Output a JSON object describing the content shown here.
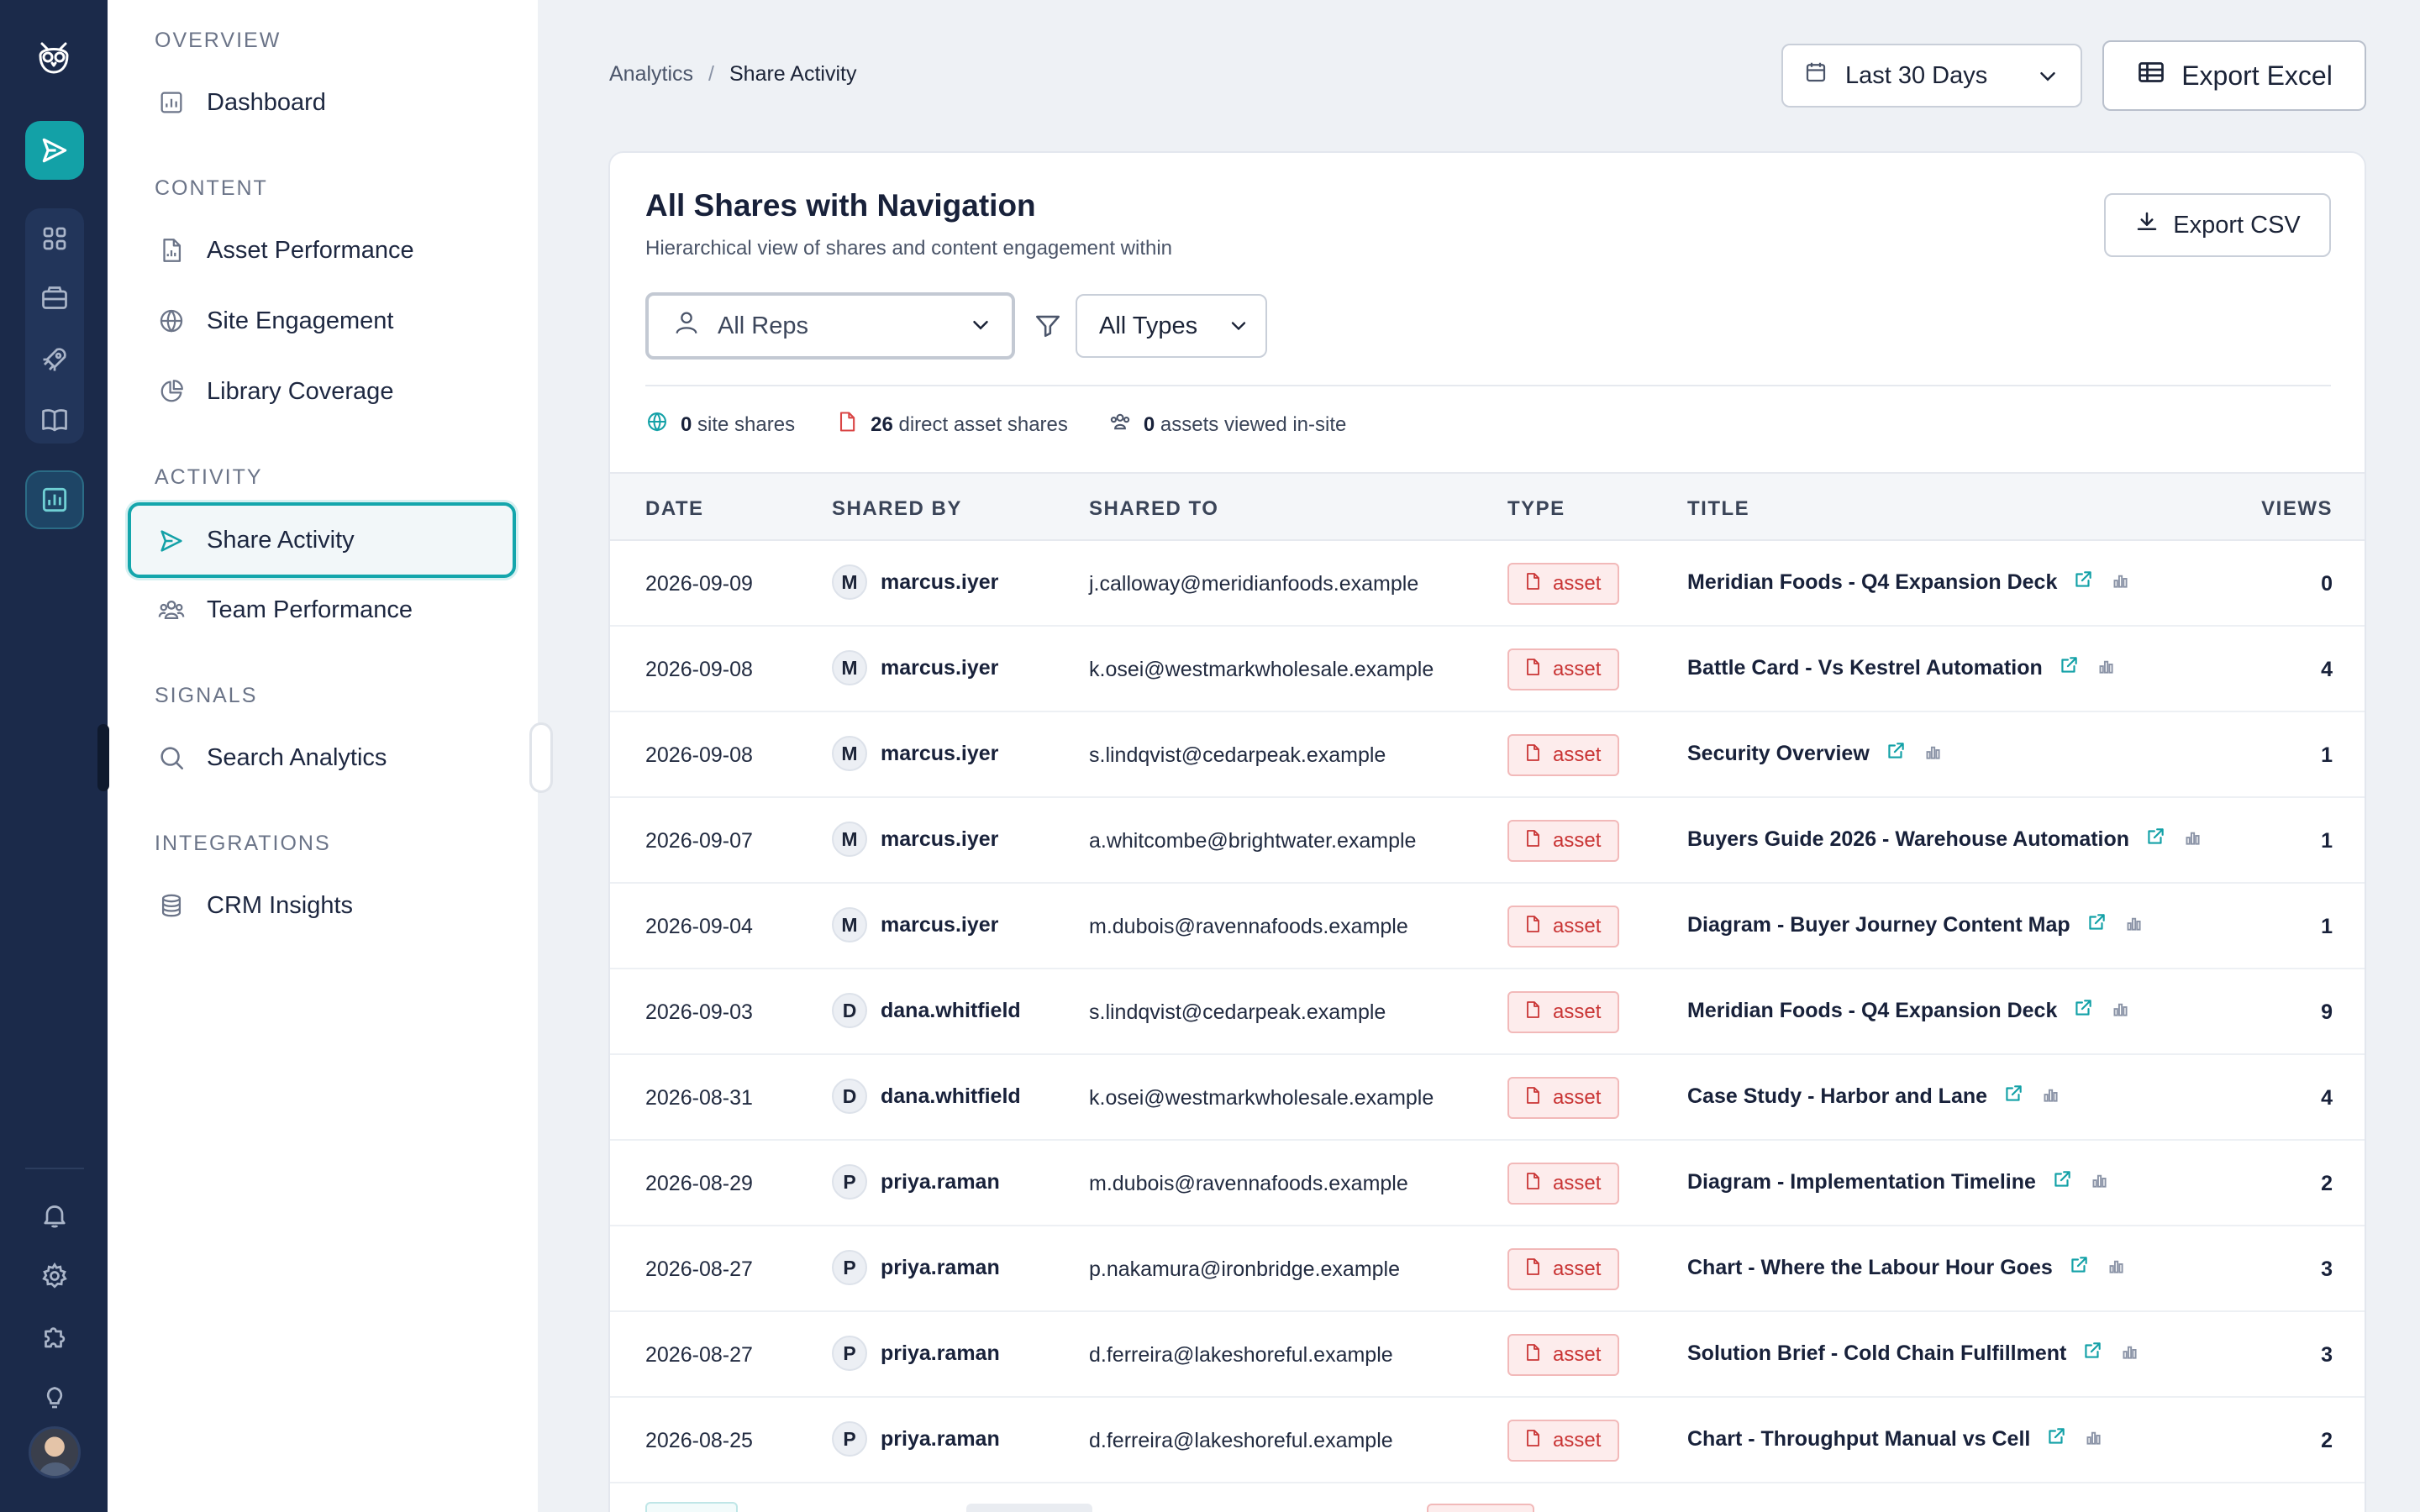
{
  "breadcrumb": {
    "parent": "Analytics",
    "separator": "/",
    "current": "Share Activity"
  },
  "date_range": {
    "value": "Last 30 Days"
  },
  "export_excel_label": "Export Excel",
  "sidebar": {
    "sections": [
      {
        "label": "OVERVIEW",
        "items": [
          {
            "label": "Dashboard",
            "icon": "bar-chart-icon"
          }
        ]
      },
      {
        "label": "CONTENT",
        "items": [
          {
            "label": "Asset Performance",
            "icon": "document-chart-icon"
          },
          {
            "label": "Site Engagement",
            "icon": "globe-icon"
          },
          {
            "label": "Library Coverage",
            "icon": "pie-chart-icon"
          }
        ]
      },
      {
        "label": "ACTIVITY",
        "items": [
          {
            "label": "Share Activity",
            "icon": "send-icon",
            "active": true
          },
          {
            "label": "Team Performance",
            "icon": "users-icon"
          }
        ]
      },
      {
        "label": "SIGNALS",
        "items": [
          {
            "label": "Search Analytics",
            "icon": "search-icon"
          }
        ]
      },
      {
        "label": "INTEGRATIONS",
        "items": [
          {
            "label": "CRM Insights",
            "icon": "database-icon"
          }
        ]
      }
    ]
  },
  "card": {
    "title": "All Shares with Navigation",
    "subtitle": "Hierarchical view of shares and content engagement within",
    "export_csv_label": "Export CSV",
    "rep_filter": "All Reps",
    "type_filter": "All Types",
    "stats": {
      "site_shares_count": "0",
      "site_shares_label": "site shares",
      "direct_count": "26",
      "direct_label": "direct asset shares",
      "viewed_count": "0",
      "viewed_label": "assets viewed in-site"
    }
  },
  "table": {
    "headers": {
      "date": "DATE",
      "shared_by": "SHARED BY",
      "shared_to": "SHARED TO",
      "type": "TYPE",
      "title": "TITLE",
      "views": "VIEWS"
    },
    "rows": [
      {
        "date": "2026-09-09",
        "initial": "M",
        "by": "marcus.iyer",
        "to": "j.calloway@meridianfoods.example",
        "type": "asset",
        "title": "Meridian Foods - Q4 Expansion Deck",
        "views": "0"
      },
      {
        "date": "2026-09-08",
        "initial": "M",
        "by": "marcus.iyer",
        "to": "k.osei@westmarkwholesale.example",
        "type": "asset",
        "title": "Battle Card - Vs Kestrel Automation",
        "views": "4"
      },
      {
        "date": "2026-09-08",
        "initial": "M",
        "by": "marcus.iyer",
        "to": "s.lindqvist@cedarpeak.example",
        "type": "asset",
        "title": "Security Overview",
        "views": "1"
      },
      {
        "date": "2026-09-07",
        "initial": "M",
        "by": "marcus.iyer",
        "to": "a.whitcombe@brightwater.example",
        "type": "asset",
        "title": "Buyers Guide 2026 - Warehouse Automation",
        "views": "1"
      },
      {
        "date": "2026-09-04",
        "initial": "M",
        "by": "marcus.iyer",
        "to": "m.dubois@ravennafoods.example",
        "type": "asset",
        "title": "Diagram - Buyer Journey Content Map",
        "views": "1"
      },
      {
        "date": "2026-09-03",
        "initial": "D",
        "by": "dana.whitfield",
        "to": "s.lindqvist@cedarpeak.example",
        "type": "asset",
        "title": "Meridian Foods - Q4 Expansion Deck",
        "views": "9"
      },
      {
        "date": "2026-08-31",
        "initial": "D",
        "by": "dana.whitfield",
        "to": "k.osei@westmarkwholesale.example",
        "type": "asset",
        "title": "Case Study - Harbor and Lane",
        "views": "4"
      },
      {
        "date": "2026-08-29",
        "initial": "P",
        "by": "priya.raman",
        "to": "m.dubois@ravennafoods.example",
        "type": "asset",
        "title": "Diagram - Implementation Timeline",
        "views": "2"
      },
      {
        "date": "2026-08-27",
        "initial": "P",
        "by": "priya.raman",
        "to": "p.nakamura@ironbridge.example",
        "type": "asset",
        "title": "Chart - Where the Labour Hour Goes",
        "views": "3"
      },
      {
        "date": "2026-08-27",
        "initial": "P",
        "by": "priya.raman",
        "to": "d.ferreira@lakeshoreful.example",
        "type": "asset",
        "title": "Solution Brief - Cold Chain Fulfillment",
        "views": "3"
      },
      {
        "date": "2026-08-25",
        "initial": "P",
        "by": "priya.raman",
        "to": "d.ferreira@lakeshoreful.example",
        "type": "asset",
        "title": "Chart - Throughput Manual vs Cell",
        "views": "2"
      }
    ]
  },
  "rail": {
    "icons": [
      "owl-logo-icon",
      "send-icon",
      "grid-icon",
      "inbox-icon",
      "rocket-icon",
      "book-icon",
      "analytics-icon",
      "bell-icon",
      "gear-icon",
      "puzzle-icon",
      "lightbulb-icon"
    ]
  },
  "colors": {
    "accent": "#13a1a7",
    "rail_bg": "#1b2a4a",
    "asset_badge": "#c93434"
  }
}
